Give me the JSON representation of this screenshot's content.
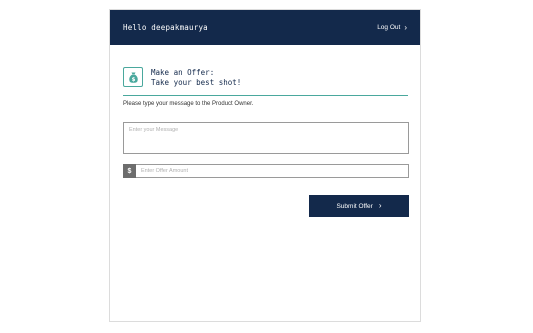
{
  "header": {
    "greeting": "Hello deepakmaurya",
    "logout_label": "Log Out"
  },
  "offer": {
    "title_line1": "Make an Offer:",
    "title_line2": "Take your best shot!",
    "icon": "money-bag-icon"
  },
  "instructions": "Please type your message to the Product Owner.",
  "message": {
    "placeholder": "Enter your Message",
    "value": ""
  },
  "amount": {
    "currency_symbol": "$",
    "placeholder": "Enter Offer Amount",
    "value": ""
  },
  "submit_label": "Submit Offer",
  "colors": {
    "header_bg": "#13294b",
    "accent": "#4aa89d",
    "button_bg": "#13294b"
  }
}
